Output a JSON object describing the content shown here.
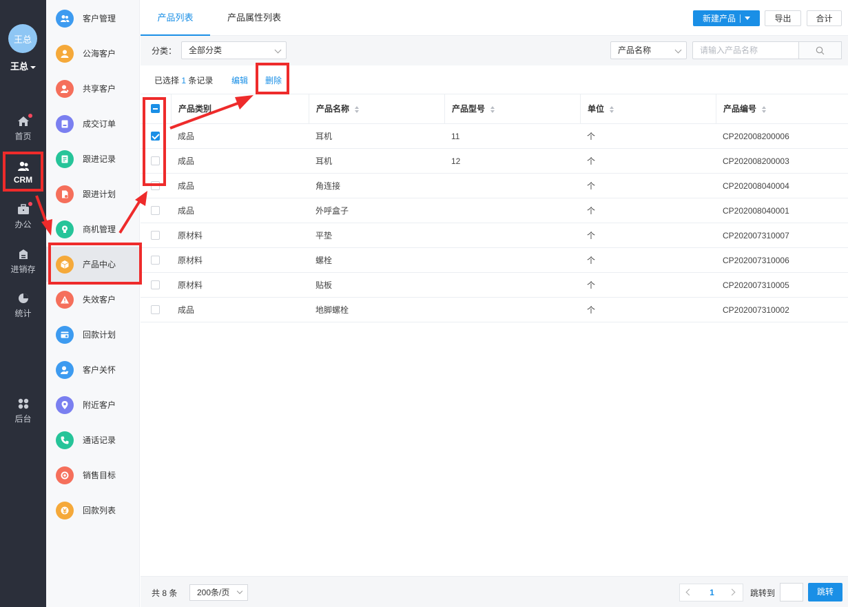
{
  "user": {
    "avatar_text": "王总",
    "name": "王总"
  },
  "rail": [
    {
      "label": "首页",
      "icon": "home-icon",
      "dot": true
    },
    {
      "label": "CRM",
      "icon": "users-icon",
      "active": true
    },
    {
      "label": "办公",
      "icon": "briefcase-icon",
      "dot": true
    },
    {
      "label": "进销存",
      "icon": "warehouse-icon"
    },
    {
      "label": "统计",
      "icon": "pie-chart-icon"
    },
    {
      "label": "后台",
      "icon": "grid-icon"
    }
  ],
  "sidebar": [
    {
      "label": "客户管理",
      "icon": "customers-icon",
      "color": "#3d9bf0"
    },
    {
      "label": "公海客户",
      "icon": "public-customer-icon",
      "color": "#f5a93a"
    },
    {
      "label": "共享客户",
      "icon": "shared-customer-icon",
      "color": "#f56f5b"
    },
    {
      "label": "成交订单",
      "icon": "order-icon",
      "color": "#7a7ff0"
    },
    {
      "label": "跟进记录",
      "icon": "record-icon",
      "color": "#26c499"
    },
    {
      "label": "跟进计划",
      "icon": "plan-icon",
      "color": "#f56f5b"
    },
    {
      "label": "商机管理",
      "icon": "lightbulb-icon",
      "color": "#26c499"
    },
    {
      "label": "产品中心",
      "icon": "box-icon",
      "color": "#f5a93a",
      "active": true
    },
    {
      "label": "失效客户",
      "icon": "warning-icon",
      "color": "#f56f5b"
    },
    {
      "label": "回款计划",
      "icon": "payment-plan-icon",
      "color": "#3d9bf0"
    },
    {
      "label": "客户关怀",
      "icon": "care-icon",
      "color": "#3d9bf0"
    },
    {
      "label": "附近客户",
      "icon": "location-icon",
      "color": "#7a7ff0"
    },
    {
      "label": "通话记录",
      "icon": "phone-icon",
      "color": "#26c499"
    },
    {
      "label": "销售目标",
      "icon": "target-icon",
      "color": "#f56f5b"
    },
    {
      "label": "回款列表",
      "icon": "payment-list-icon",
      "color": "#f5a93a"
    }
  ],
  "tabs": [
    "产品列表",
    "产品属性列表"
  ],
  "toolbar": {
    "new_label": "新建产品",
    "export_label": "导出",
    "sum_label": "合计"
  },
  "filter": {
    "label": "分类：",
    "category": "全部分类",
    "search_field": "产品名称",
    "search_placeholder": "请输入产品名称"
  },
  "selection": {
    "prefix": "已选择",
    "count": "1",
    "suffix": "条记录",
    "edit": "编辑",
    "delete": "删除"
  },
  "table": {
    "headers": [
      "产品类别",
      "产品名称",
      "产品型号",
      "单位",
      "产品编号"
    ],
    "rows": [
      {
        "checked": true,
        "cells": [
          "成品",
          "耳机",
          "11",
          "个",
          "CP202008200006"
        ]
      },
      {
        "checked": false,
        "cells": [
          "成品",
          "耳机",
          "12",
          "个",
          "CP202008200003"
        ]
      },
      {
        "checked": false,
        "cells": [
          "成品",
          "角连接",
          "",
          "个",
          "CP202008040004"
        ]
      },
      {
        "checked": false,
        "cells": [
          "成品",
          "外呼盒子",
          "",
          "个",
          "CP202008040001"
        ]
      },
      {
        "checked": false,
        "cells": [
          "原材料",
          "平垫",
          "",
          "个",
          "CP202007310007"
        ]
      },
      {
        "checked": false,
        "cells": [
          "原材料",
          "螺栓",
          "",
          "个",
          "CP202007310006"
        ]
      },
      {
        "checked": false,
        "cells": [
          "原材料",
          "贴板",
          "",
          "个",
          "CP202007310005"
        ]
      },
      {
        "checked": false,
        "cells": [
          "成品",
          "地脚螺栓",
          "",
          "个",
          "CP202007310002"
        ]
      }
    ]
  },
  "footer": {
    "total": "共 8 条",
    "page_size": "200条/页",
    "current_page": "1",
    "jump_label": "跳转到",
    "jump_button": "跳转"
  },
  "colors": {
    "accent": "#1a8fe6",
    "highlight": "#ee2b2b",
    "rail_bg": "#2b2f3a"
  }
}
